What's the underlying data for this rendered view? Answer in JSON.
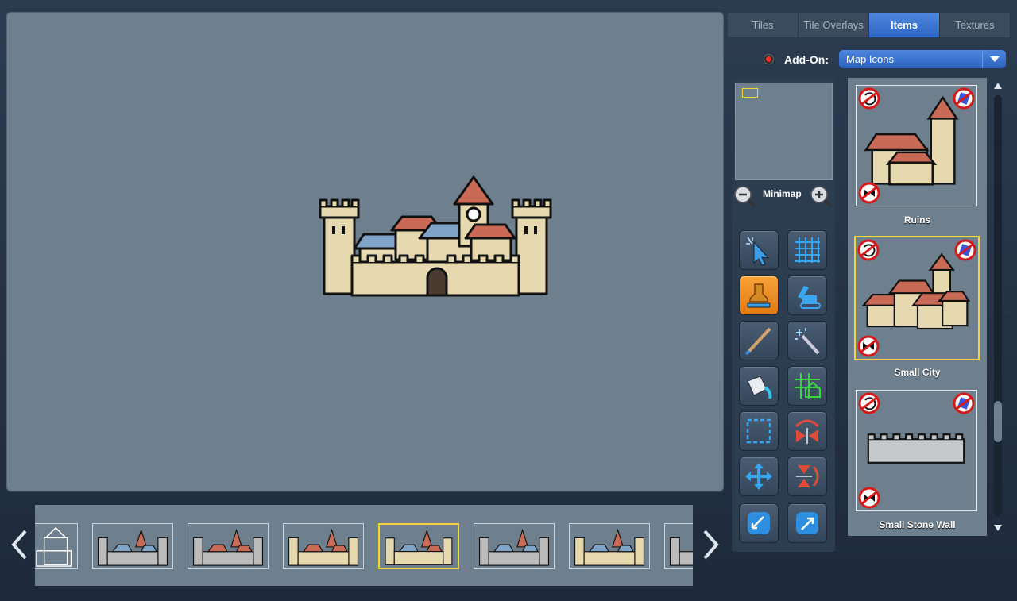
{
  "tabs": [
    {
      "label": "Tiles"
    },
    {
      "label": "Tile Overlays"
    },
    {
      "label": "Items",
      "active": true
    },
    {
      "label": "Textures"
    }
  ],
  "addon": {
    "label": "Add-On:",
    "selected": "Map Icons"
  },
  "minimap": {
    "label": "Minimap"
  },
  "tools": [
    {
      "icon": "select-arrow-icon"
    },
    {
      "icon": "grid-icon"
    },
    {
      "icon": "stamp-icon",
      "active": true
    },
    {
      "icon": "excavator-icon"
    },
    {
      "icon": "brush-icon"
    },
    {
      "icon": "magic-wand-icon"
    },
    {
      "icon": "paint-bucket-icon"
    },
    {
      "icon": "grid-house-icon"
    },
    {
      "icon": "marquee-select-icon"
    },
    {
      "icon": "flip-horizontal-icon"
    },
    {
      "icon": "move-icon"
    },
    {
      "icon": "flip-vertical-icon"
    },
    {
      "icon": "import-icon"
    },
    {
      "icon": "export-icon"
    }
  ],
  "items": [
    {
      "label": "Ruins"
    },
    {
      "label": "Small City",
      "selected": true
    },
    {
      "label": "Small Stone Wall"
    }
  ],
  "filmstrip": {
    "thumbnails": [
      "castle-variant-outline",
      "castle-variant-gray",
      "castle-variant-red",
      "castle-variant-tan",
      "castle-variant-selected",
      "castle-variant-blue",
      "castle-variant-tan-blue",
      "castle-variant-gray-partial"
    ],
    "selected_index": 4
  },
  "colors": {
    "canvas": "#6e7f8d",
    "accent_blue": "#3a72d2",
    "selection_yellow": "#f3d43a",
    "active_tool_orange": "#f0901f"
  }
}
